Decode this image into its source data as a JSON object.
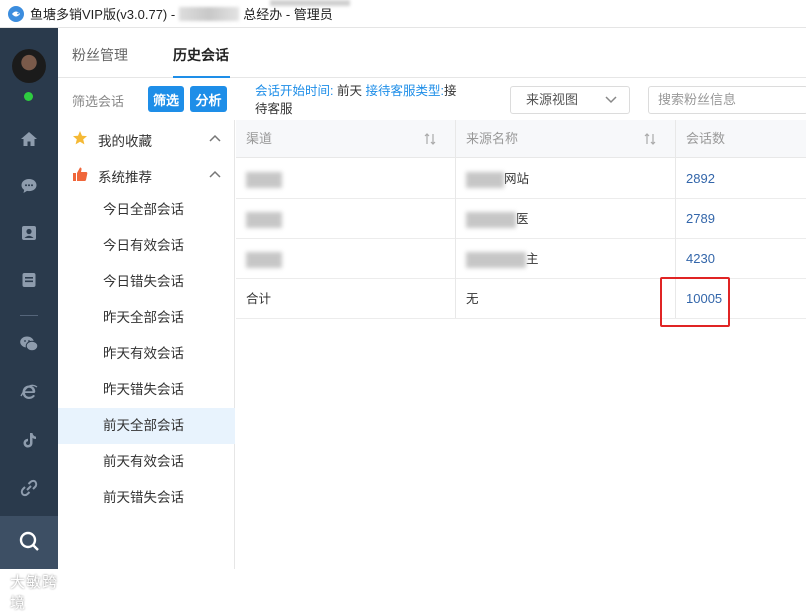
{
  "window": {
    "title_prefix": "鱼塘多销VIP版(v3.0.77) -",
    "title_suffix": "总经办 - 管理员"
  },
  "nav": {
    "tabs": [
      {
        "label": "粉丝管理",
        "active": false
      },
      {
        "label": "历史会话",
        "active": true
      }
    ]
  },
  "filter": {
    "label": "筛选会话",
    "filter_button": "筛选",
    "analyze_button": "分析",
    "conditions": {
      "start_key": "会话开始时间:",
      "start_val": "前天",
      "type_key": "接待客服类型:",
      "type_val_1": "接",
      "type_val_2": "待客服"
    },
    "source_view": "来源视图",
    "search_placeholder": "搜索粉丝信息"
  },
  "sidebar": {
    "groups": [
      {
        "label": "我的收藏",
        "icon": "star-icon",
        "expanded": true
      },
      {
        "label": "系统推荐",
        "icon": "thumbs-up-icon",
        "expanded": true
      }
    ],
    "items": [
      {
        "label": "今日全部会话",
        "active": false
      },
      {
        "label": "今日有效会话",
        "active": false
      },
      {
        "label": "今日错失会话",
        "active": false
      },
      {
        "label": "昨天全部会话",
        "active": false
      },
      {
        "label": "昨天有效会话",
        "active": false
      },
      {
        "label": "昨天错失会话",
        "active": false
      },
      {
        "label": "前天全部会话",
        "active": true
      },
      {
        "label": "前天有效会话",
        "active": false
      },
      {
        "label": "前天错失会话",
        "active": false
      }
    ]
  },
  "table": {
    "columns": [
      "渠道",
      "来源名称",
      "会话数"
    ],
    "rows": [
      {
        "channel": "",
        "source": "网站",
        "count": "2892"
      },
      {
        "channel": "",
        "source": "医",
        "count": "2789"
      },
      {
        "channel": "",
        "source": "主",
        "count": "4230"
      },
      {
        "channel": "合计",
        "source": "无",
        "count": "10005"
      }
    ]
  },
  "watermark": "大敏跨境",
  "colors": {
    "accent": "#1e8ee8",
    "rail": "#2a3a4c",
    "highlight": "#e02424",
    "active_row": "#e8f3fd"
  }
}
